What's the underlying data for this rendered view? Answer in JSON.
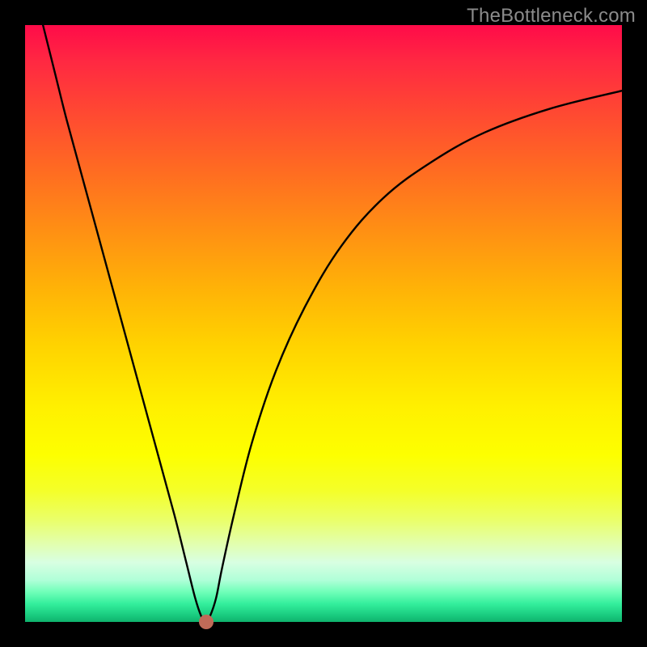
{
  "watermark": "TheBottleneck.com",
  "chart_data": {
    "type": "line",
    "title": "",
    "xlabel": "",
    "ylabel": "",
    "xlim": [
      0,
      100
    ],
    "ylim": [
      0,
      100
    ],
    "grid": false,
    "legend": false,
    "series": [
      {
        "name": "bottleneck-curve",
        "x": [
          3,
          5,
          7,
          10,
          13,
          16,
          19,
          22,
          25,
          27,
          28.5,
          29.5,
          30,
          30.5,
          31,
          32,
          33,
          35,
          38,
          42,
          47,
          53,
          60,
          68,
          77,
          88,
          100
        ],
        "y": [
          100,
          92,
          84,
          73,
          62,
          51,
          40,
          29,
          18,
          10,
          4,
          1,
          0.5,
          0.5,
          1,
          4,
          9,
          18,
          30,
          42,
          53,
          63,
          71,
          77,
          82,
          86,
          89
        ]
      }
    ],
    "minimum_point": {
      "x": 30.3,
      "y": 0
    },
    "annotations": []
  },
  "colors": {
    "curve": "#000000",
    "dot": "#c06a58",
    "watermark": "#8b8b8b",
    "gradient_top": "#ff0b49",
    "gradient_bottom": "#0fb26d"
  }
}
